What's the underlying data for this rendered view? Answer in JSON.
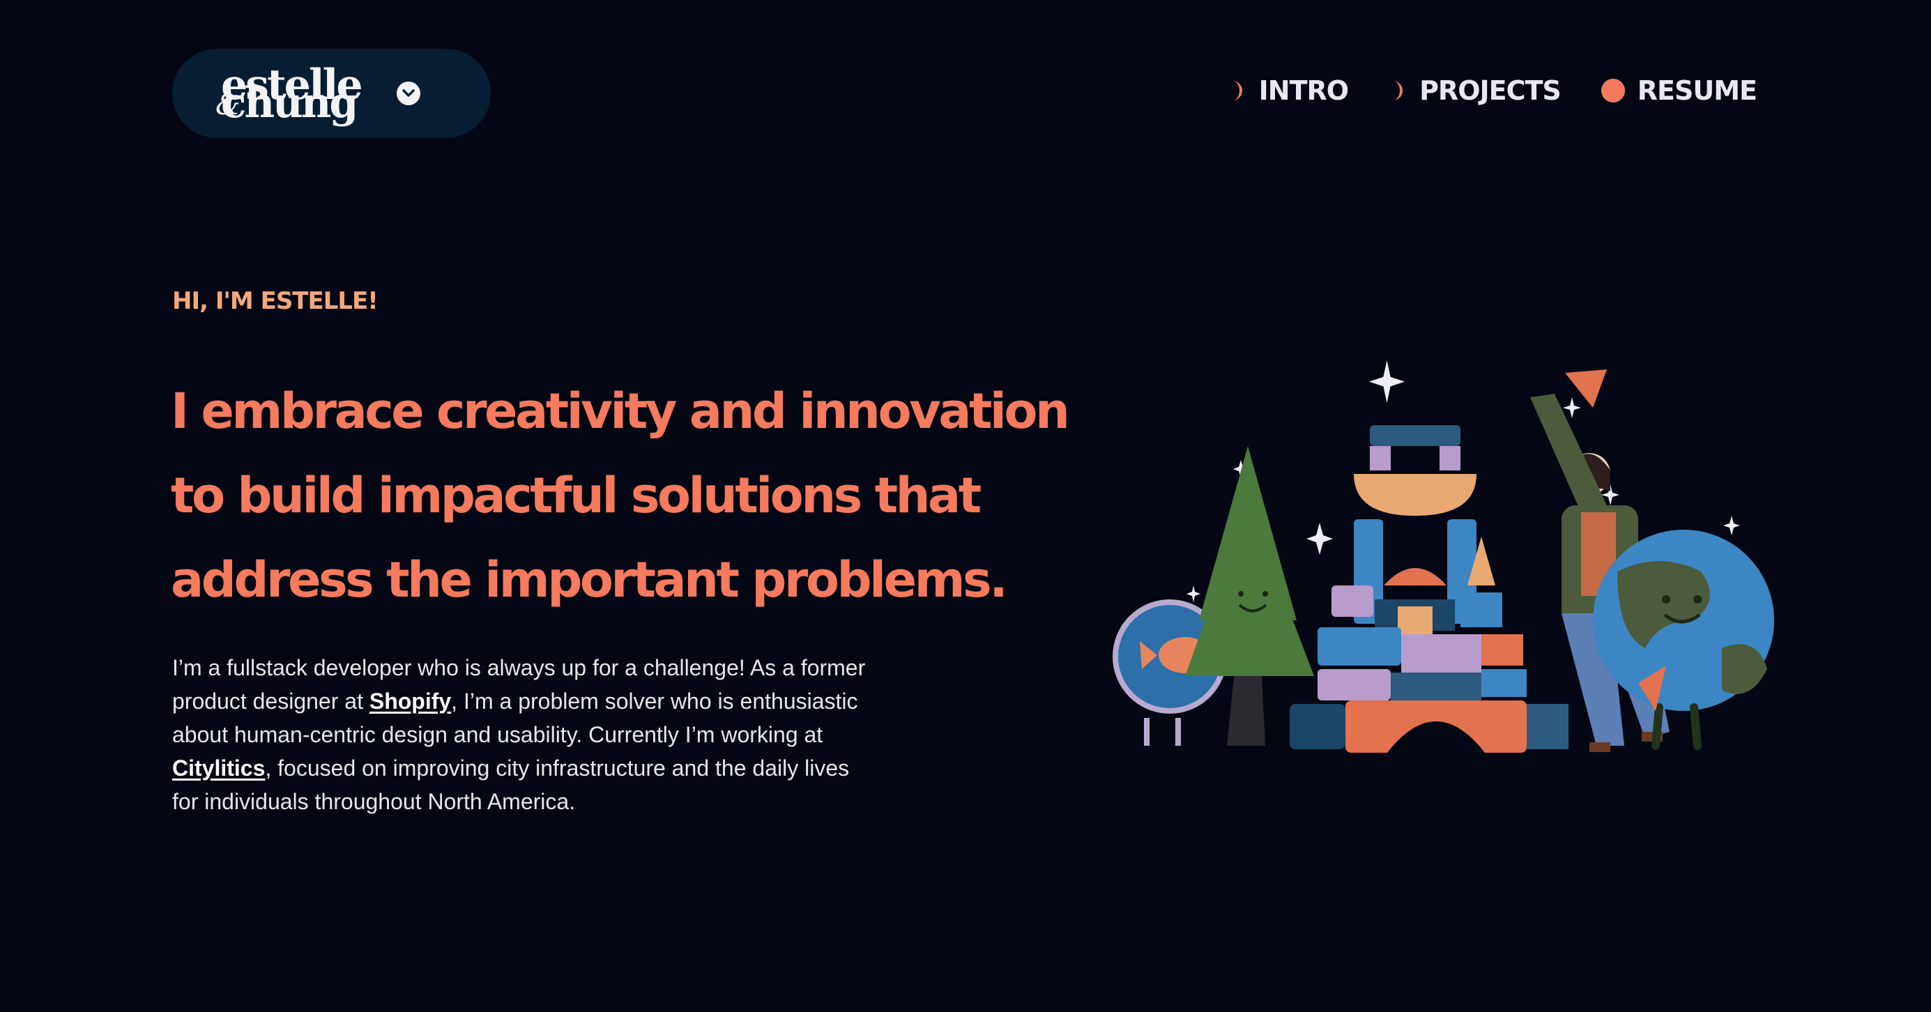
{
  "header": {
    "logo": {
      "word_top": "estelle",
      "word_bottom": "chung",
      "ampersand": "&"
    },
    "nav": [
      {
        "label": "INTRO",
        "icon": "crescent-moon-icon"
      },
      {
        "label": "PROJECTS",
        "icon": "crescent-moon-icon"
      },
      {
        "label": "RESUME",
        "icon": "filled-circle-icon"
      }
    ]
  },
  "hero": {
    "greeting": "HI, I'M ESTELLE!",
    "headline": "I embrace creativity and innovation to build impactful solutions that address the important problems.",
    "intro": {
      "part1": "I’m a fullstack developer who is always up for a challenge! As a former product designer at ",
      "link1": "Shopify",
      "part2": ", I’m a problem solver who is enthusiastic about human-centric design and usability. Currently I’m working at ",
      "link2": "Citylitics",
      "part3": ", focused on improving city infrastructure and the daily lives for individuals throughout North America."
    }
  },
  "colors": {
    "background": "#040713",
    "accent_coral": "#f57a5e",
    "accent_peach": "#f4a87c",
    "logo_pill": "#071d33",
    "text": "#e8e9ee"
  }
}
